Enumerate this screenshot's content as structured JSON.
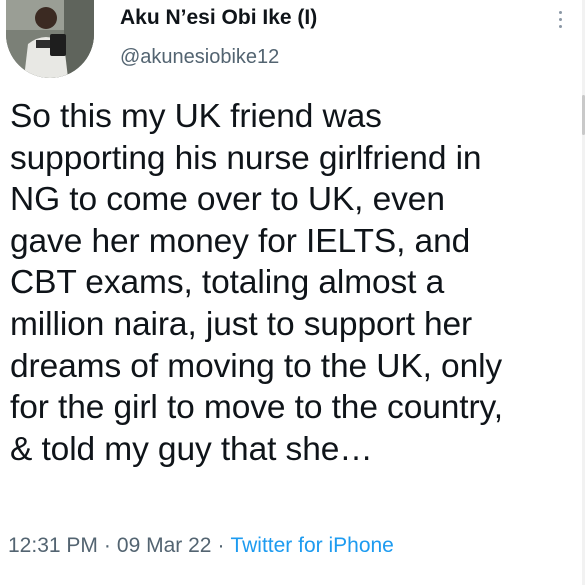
{
  "author": {
    "display_name": "Aku N’esi Obi Ike (I)",
    "handle": "@akunesiobike12",
    "avatar_icon": "profile-photo"
  },
  "tweet": {
    "text": "So this my UK friend was\nsupporting his nurse girlfriend in\nNG to come over to UK, even\ngave her money for IELTS, and\nCBT exams, totaling almost a\nmillion naira, just to support her\ndreams of moving to the UK, only\nfor the girl to move to the country,\n& told my guy that she…"
  },
  "meta": {
    "time": "12:31 PM",
    "separator": "·",
    "date": "09 Mar 22",
    "source": "Twitter for iPhone"
  },
  "colors": {
    "text": "#0f1419",
    "secondary": "#536471",
    "link": "#1d9bf0"
  }
}
